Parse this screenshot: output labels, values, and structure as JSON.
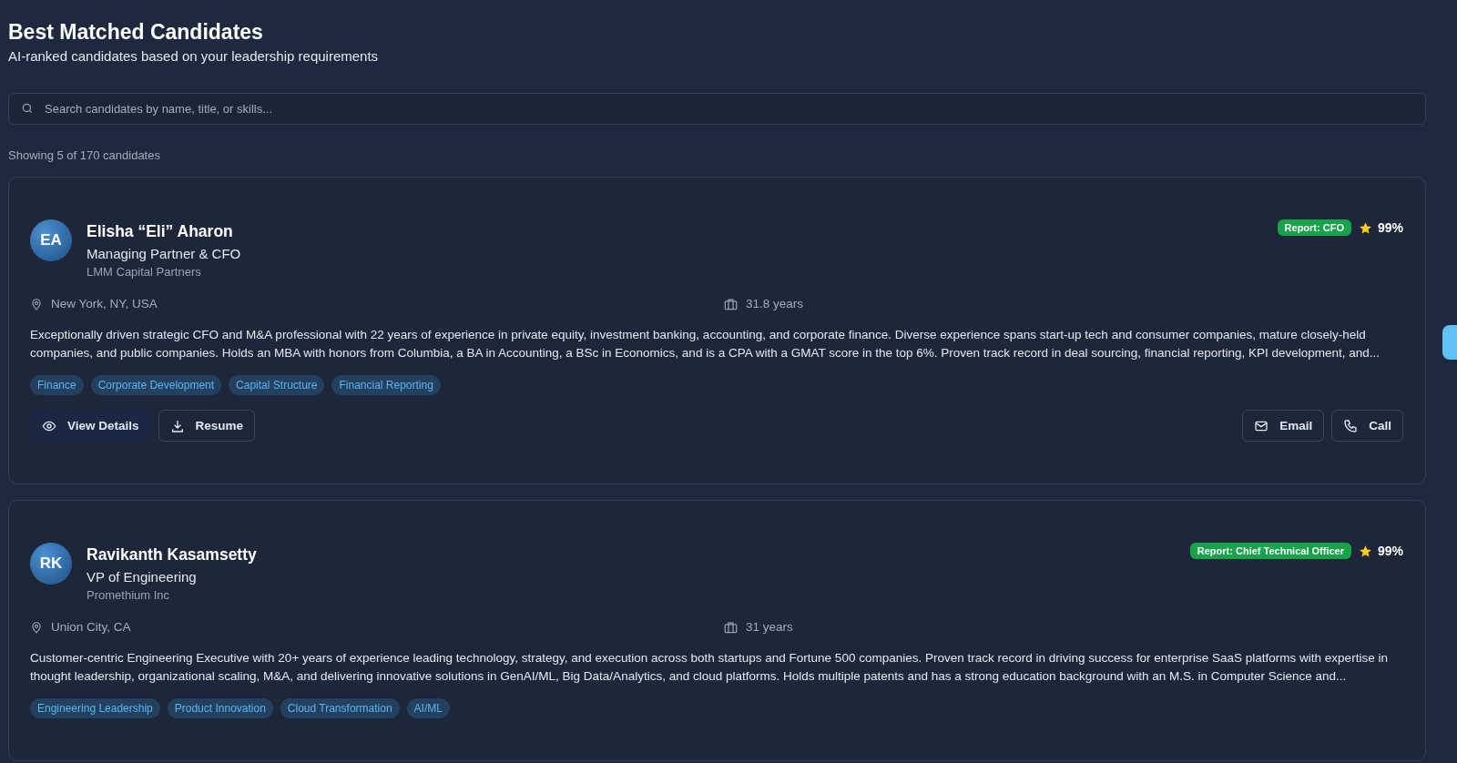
{
  "header": {
    "title": "Best Matched Candidates",
    "subtitle": "AI-ranked candidates based on your leadership requirements"
  },
  "search": {
    "placeholder": "Search candidates by name, title, or skills..."
  },
  "count": "Showing 5 of 170 candidates",
  "candidates": [
    {
      "initials": "EA",
      "name": "Elisha “Eli” Aharon",
      "title": "Managing Partner & CFO",
      "company": "LMM Capital Partners",
      "report": "Report: CFO",
      "score": "99%",
      "location": "New York, NY, USA",
      "experience": "31.8 years",
      "summary": "Exceptionally driven strategic CFO and M&A professional with 22 years of experience in private equity, investment banking, accounting, and corporate finance. Diverse experience spans start-up tech and consumer companies, mature closely-held companies, and public companies. Holds an MBA with honors from Columbia, a BA in Accounting, a BSc in Economics, and is a CPA with a GMAT score in the top 6%. Proven track record in deal sourcing, financial reporting, KPI development, and...",
      "skills": [
        "Finance",
        "Corporate Development",
        "Capital Structure",
        "Financial Reporting"
      ],
      "actions": [
        {
          "kind": "details",
          "label": "View Details"
        },
        {
          "kind": "resume",
          "label": "Resume"
        },
        {
          "kind": "email",
          "label": "Email"
        },
        {
          "kind": "call",
          "label": "Call"
        }
      ]
    },
    {
      "initials": "RK",
      "name": "Ravikanth Kasamsetty",
      "title": "VP of Engineering",
      "company": "Promethium Inc",
      "report": "Report: Chief Technical Officer",
      "score": "99%",
      "location": "Union City, CA",
      "experience": "31 years",
      "summary": "Customer-centric Engineering Executive with 20+ years of experience leading technology, strategy, and execution across both startups and Fortune 500 companies. Proven track record in driving success for enterprise SaaS platforms with expertise in thought leadership, organizational scaling, M&A, and delivering innovative solutions in GenAI/ML, Big Data/Analytics, and cloud platforms. Holds multiple patents and has a strong education background with an M.S. in Computer Science and...",
      "skills": [
        "Engineering Leadership",
        "Product Innovation",
        "Cloud Transformation",
        "AI/ML"
      ]
    }
  ]
}
